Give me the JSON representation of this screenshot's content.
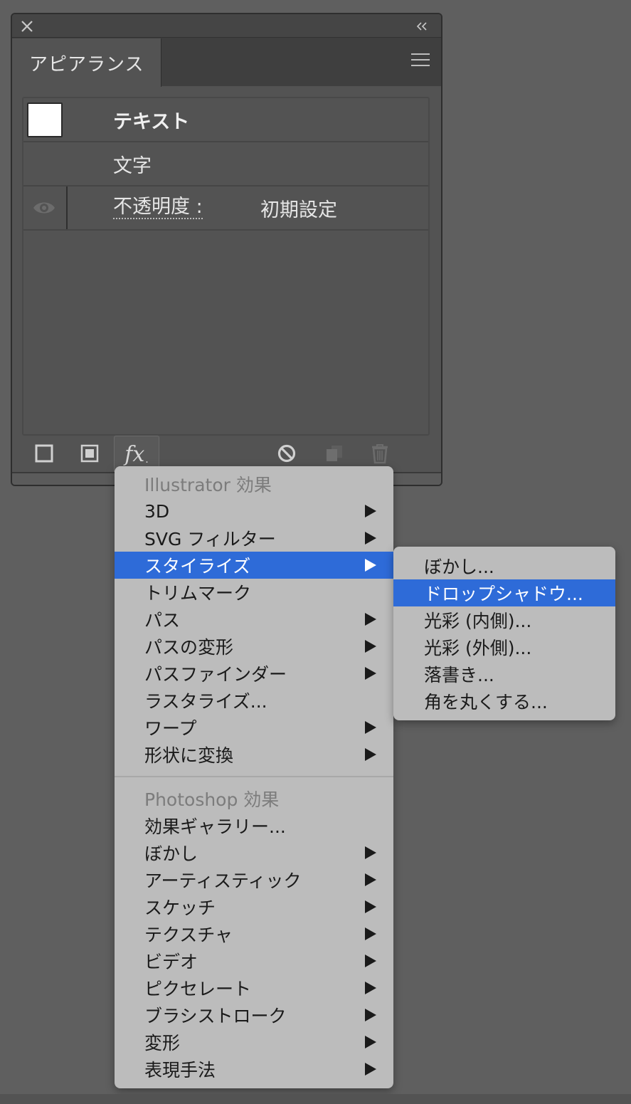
{
  "panel": {
    "tab_label": "アピアランス",
    "rows": {
      "object_type": "テキスト",
      "character": "文字",
      "opacity_label": "不透明度 :",
      "opacity_value": "初期設定"
    },
    "icons": {
      "close": "close-icon",
      "collapse": "double-chevron-left-icon",
      "menu": "hamburger-menu-icon",
      "visibility": "eye-icon",
      "add_stroke": "add-new-stroke-icon",
      "add_fill": "add-new-fill-icon",
      "fx": "fx-icon",
      "clear": "clear-appearance-icon",
      "duplicate": "duplicate-item-icon",
      "delete": "trash-icon"
    },
    "fx_label": "fx",
    "fx_sub": "."
  },
  "effects_menu": {
    "illustrator_header": "Illustrator 効果",
    "illustrator_items": [
      {
        "label": "3D",
        "submenu": true
      },
      {
        "label": "SVG フィルター",
        "submenu": true
      },
      {
        "label": "スタイライズ",
        "submenu": true,
        "active": true
      },
      {
        "label": "トリムマーク",
        "submenu": false
      },
      {
        "label": "パス",
        "submenu": true
      },
      {
        "label": "パスの変形",
        "submenu": true
      },
      {
        "label": "パスファインダー",
        "submenu": true
      },
      {
        "label": "ラスタライズ...",
        "submenu": false
      },
      {
        "label": "ワープ",
        "submenu": true
      },
      {
        "label": "形状に変換",
        "submenu": true
      }
    ],
    "photoshop_header": "Photoshop 効果",
    "photoshop_items": [
      {
        "label": "効果ギャラリー...",
        "submenu": false
      },
      {
        "label": "ぼかし",
        "submenu": true
      },
      {
        "label": "アーティスティック",
        "submenu": true
      },
      {
        "label": "スケッチ",
        "submenu": true
      },
      {
        "label": "テクスチャ",
        "submenu": true
      },
      {
        "label": "ビデオ",
        "submenu": true
      },
      {
        "label": "ピクセレート",
        "submenu": true
      },
      {
        "label": "ブラシストローク",
        "submenu": true
      },
      {
        "label": "変形",
        "submenu": true
      },
      {
        "label": "表現手法",
        "submenu": true
      }
    ]
  },
  "stylize_submenu": {
    "items": [
      {
        "label": "ぼかし..."
      },
      {
        "label": "ドロップシャドウ...",
        "active": true
      },
      {
        "label": "光彩 (内側)..."
      },
      {
        "label": "光彩 (外側)..."
      },
      {
        "label": "落書き..."
      },
      {
        "label": "角を丸くする..."
      }
    ]
  },
  "colors": {
    "highlight": "#2e6bd8",
    "menu_bg": "#bcbcbc",
    "panel_bg": "#535353",
    "workspace_bg": "#5f5f5f"
  }
}
